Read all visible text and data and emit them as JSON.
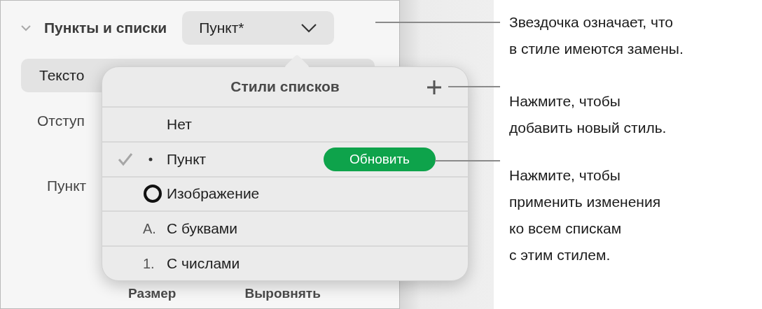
{
  "section": {
    "title": "Пункты и списки",
    "expanded": true,
    "style_menu": {
      "value": "Пункт*"
    }
  },
  "text_button": {
    "label": "Тексто"
  },
  "side_labels": [
    {
      "text": "Отступ"
    },
    {
      "text": "Пункт"
    }
  ],
  "footer_labels": [
    "Размер",
    "Выровнять"
  ],
  "popover": {
    "title": "Стили списков",
    "items": [
      {
        "kind": "none",
        "label": "Нет",
        "selected": false
      },
      {
        "kind": "bullet",
        "label": "Пункт",
        "selected": true,
        "update_button": "Обновить"
      },
      {
        "kind": "image",
        "label": "Изображение",
        "selected": false
      },
      {
        "kind": "letter",
        "marker": "A.",
        "label": "С буквами",
        "selected": false
      },
      {
        "kind": "number",
        "marker": "1.",
        "label": "С числами",
        "selected": false
      }
    ]
  },
  "callouts": [
    {
      "lines": [
        "Звездочка означает, что",
        "в стиле имеются замены."
      ]
    },
    {
      "lines": [
        "Нажмите, чтобы",
        "добавить новый стиль."
      ]
    },
    {
      "lines": [
        "Нажмите, чтобы",
        "применить изменения",
        "ко всем спискам",
        "с этим стилем."
      ]
    }
  ]
}
